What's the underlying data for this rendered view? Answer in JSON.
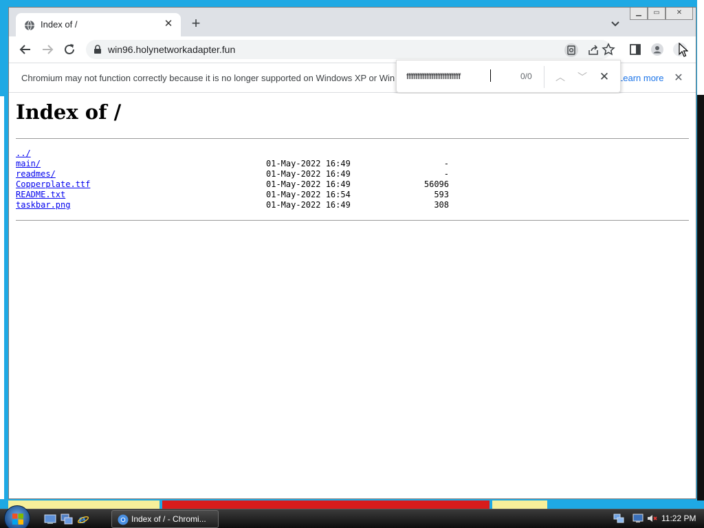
{
  "browser": {
    "tab_title": "Index of /",
    "new_tab_glyph": "+",
    "url": "win96.holynetworkadapter.fun",
    "infobar": {
      "message": "Chromium may not function correctly because it is no longer supported on Windows XP or Win",
      "learn_more": "Learn more"
    },
    "find": {
      "query": "ffffffffffffffffffffffffffffff",
      "count": "0/0"
    }
  },
  "page": {
    "heading": "Index of /",
    "parent_link": "../",
    "entries": [
      {
        "name": "main/",
        "date": "01-May-2022 16:49",
        "size": "-"
      },
      {
        "name": "readmes/",
        "date": "01-May-2022 16:49",
        "size": "-"
      },
      {
        "name": "Copperplate.ttf",
        "date": "01-May-2022 16:49",
        "size": "56096"
      },
      {
        "name": "README.txt",
        "date": "01-May-2022 16:54",
        "size": "593"
      },
      {
        "name": "taskbar.png",
        "date": "01-May-2022 16:49",
        "size": "308"
      }
    ]
  },
  "taskbar": {
    "task_label": "Index of / - Chromi...",
    "clock": "11:22 PM"
  },
  "icons": [
    "globe-icon",
    "close-icon",
    "plus-icon",
    "chevron-down-icon",
    "back-icon",
    "forward-icon",
    "reload-icon",
    "lock-icon",
    "find-icon",
    "share-icon",
    "star-icon",
    "side-panel-icon",
    "profile-icon",
    "menu-icon",
    "up-arrow-icon",
    "down-arrow-icon",
    "windows-start-icon"
  ],
  "colors": {
    "desktop": "#1fa9e4",
    "tabstrip": "#dee1e6",
    "link": "#0000ee",
    "learn_more": "#1a73e8"
  }
}
